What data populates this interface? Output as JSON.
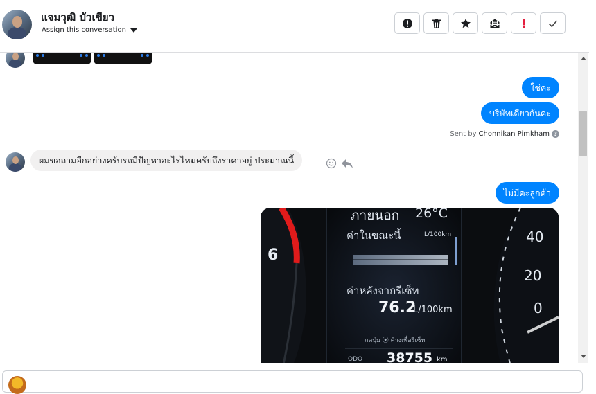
{
  "header": {
    "contact_name": "แจมวุฒิ บัวเขียว",
    "assign_label": "Assign this conversation"
  },
  "toolbar": {
    "buttons": [
      {
        "name": "spam-button",
        "icon": "alert-circle-icon"
      },
      {
        "name": "delete-button",
        "icon": "trash-icon"
      },
      {
        "name": "star-button",
        "icon": "star-icon"
      },
      {
        "name": "mark-unread-button",
        "icon": "envelope-icon"
      },
      {
        "name": "follow-up-button",
        "icon": "exclamation-icon"
      },
      {
        "name": "done-button",
        "icon": "check-icon"
      }
    ],
    "accent_red": "#e41e3f"
  },
  "messages": {
    "out1": "ใช่คะ",
    "out2": "บริษัทเดียวกันคะ",
    "sent_by_prefix": "Sent by",
    "sent_by_name": "Chonnikan Pimkham",
    "help_glyph": "?",
    "in1": "ผมขอถามอีกอย่างครับรถมีปัญหาอะไรไหมครับถึงราคาอยู่ ประมาณนี้",
    "out3": "ไม่มีคะลูกค้า"
  },
  "photo": {
    "outside_label": "ภายนอก",
    "outside_temp": "26°C",
    "current_label": "ค่าในขณะนี้",
    "current_unit": "L/100km",
    "after_reset_label": "ค่าหลังจากรีเซ็ท",
    "after_reset_value": "76.2",
    "after_reset_unit": "L/100km",
    "hint": "กดปุ่ม ⦿ ค้างเพื่อรีเซ็ท",
    "odo_label": "ODO",
    "odo_value": "38755",
    "odo_unit": "km",
    "left_dial_number": "6",
    "right_dial_labels": [
      "40",
      "20",
      "0"
    ]
  },
  "colors": {
    "bubble_out": "#0084ff",
    "bubble_in": "#f1f0f0"
  }
}
